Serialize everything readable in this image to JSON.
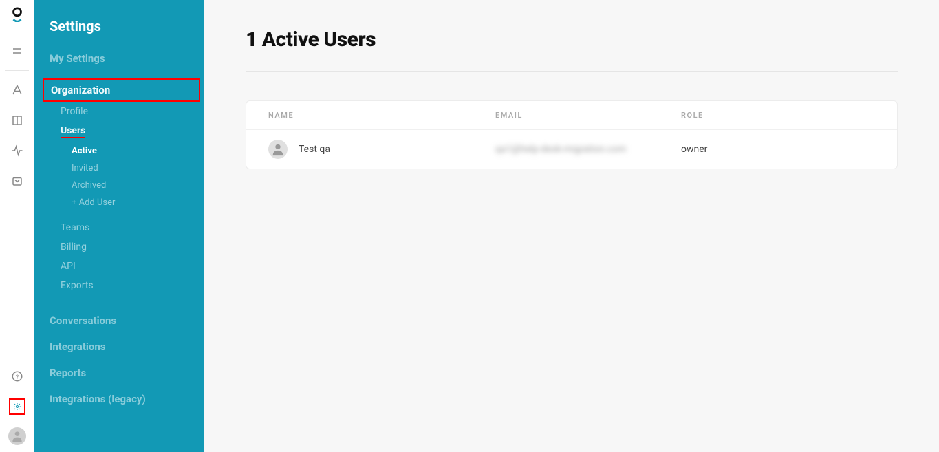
{
  "rail": {
    "items": [
      "menu",
      "assist",
      "library",
      "activity",
      "inbox"
    ],
    "bottom": [
      "help",
      "settings",
      "avatar"
    ]
  },
  "sidebar": {
    "title": "Settings",
    "my_settings": "My Settings",
    "organization": "Organization",
    "org_subs": {
      "profile": "Profile",
      "users": "Users",
      "users_subs": {
        "active": "Active",
        "invited": "Invited",
        "archived": "Archived",
        "add_user": "+ Add User"
      },
      "teams": "Teams",
      "billing": "Billing",
      "api": "API",
      "exports": "Exports"
    },
    "conversations": "Conversations",
    "integrations": "Integrations",
    "reports": "Reports",
    "integrations_legacy": "Integrations (legacy)"
  },
  "page": {
    "title": "1 Active Users",
    "columns": {
      "name": "NAME",
      "email": "EMAIL",
      "role": "ROLE"
    },
    "rows": [
      {
        "name": "Test qa",
        "email": "qa1@help-desk-migration.com",
        "role": "owner"
      }
    ]
  }
}
